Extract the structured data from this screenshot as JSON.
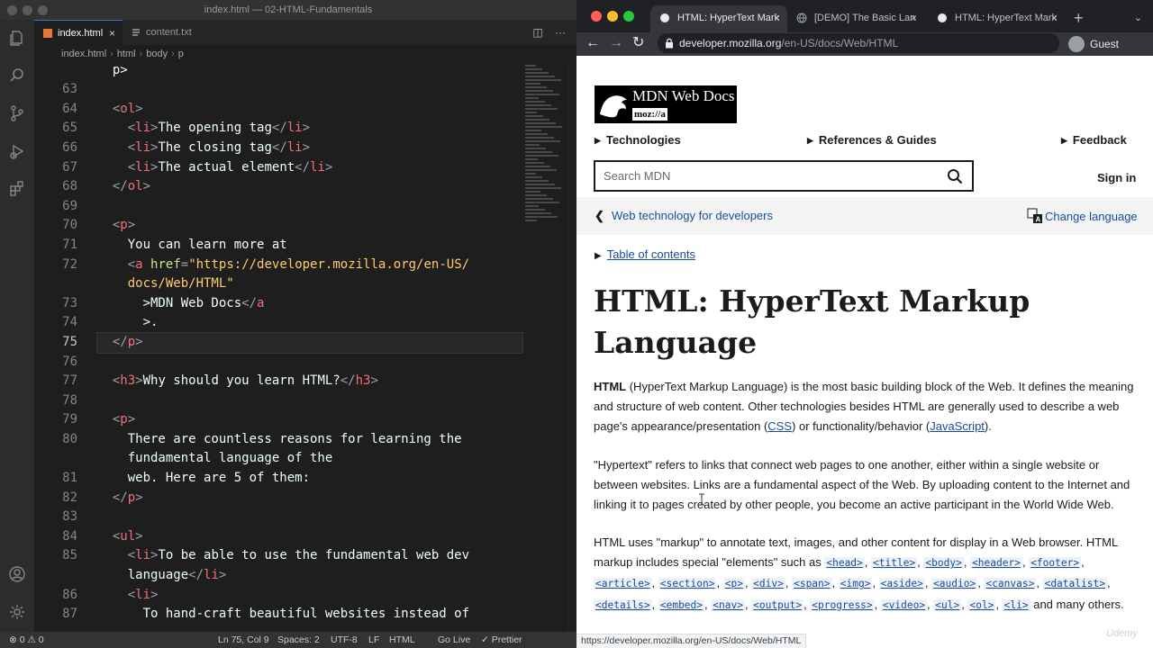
{
  "vscode": {
    "title": "index.html — 02-HTML-Fundamentals",
    "tabs": [
      {
        "label": "index.html",
        "close": "×"
      },
      {
        "label": "content.txt"
      }
    ],
    "breadcrumb": [
      "index.html",
      "html",
      "body",
      "p"
    ],
    "line_numbers": [
      "",
      "",
      "63",
      "64",
      "65",
      "66",
      "67",
      "68",
      "69",
      "70",
      "71",
      "72",
      "",
      "73",
      "74",
      "75",
      "76",
      "77",
      "78",
      "79",
      "80",
      "",
      "81",
      "82",
      "83",
      "84",
      "85",
      "",
      "86",
      "87"
    ],
    "current_line": "75",
    "status": {
      "problems": "⊗ 0 ⚠ 0",
      "position": "Ln 75, Col 9",
      "spaces": "Spaces: 2",
      "encoding": "UTF-8",
      "eol": "LF",
      "language": "HTML",
      "golive": "Go Live",
      "prettier": "✓ Prettier"
    },
    "icons": [
      "files-icon",
      "search-icon",
      "source-control-icon",
      "run-debug-icon",
      "extensions-icon",
      "account-icon",
      "settings-gear-icon"
    ]
  },
  "chrome": {
    "tabs": [
      {
        "label": "HTML: HyperText Mark",
        "close": "×"
      },
      {
        "label": "[DEMO] The Basic Lan",
        "close": "×"
      },
      {
        "label": "HTML: HyperText Mark",
        "close": "×"
      }
    ],
    "new_tab": "+",
    "url_host": "developer.mozilla.org",
    "url_path": "/en-US/docs/Web/HTML",
    "profile": "Guest",
    "status_url": "https://developer.mozilla.org/en-US/docs/Web/HTML",
    "colors": {
      "close": "#ff5f57",
      "minimize": "#febc2e",
      "zoom": "#28c840"
    }
  },
  "mdn": {
    "logo_text": "MDN Web Docs",
    "logo_sub": "moz://a",
    "nav": [
      "Technologies",
      "References & Guides",
      "Feedback"
    ],
    "search_placeholder": "Search MDN",
    "sign_in": "Sign in",
    "crumb": "Web technology for developers",
    "change_language": "Change language",
    "toc": "Table of contents",
    "title": "HTML: HyperText Markup Language",
    "p1": {
      "bold": "HTML",
      "text1": " (HyperText Markup Language) is the most basic building block of the Web. It defines the meaning and structure of web content. Other technologies besides HTML are generally used to describe a web page's appearance/presentation (",
      "link1": "CSS",
      "text2": ") or functionality/behavior (",
      "link2": "JavaScript",
      "text3": ")."
    },
    "p2": "\"Hypertext\" refers to links that connect web pages to one another, either within a single website or between websites. Links are a fundamental aspect of the Web. By uploading content to the Internet and linking it to pages created by other people, you become an active participant in the World Wide Web.",
    "p3": {
      "text1": "HTML uses \"markup\" to annotate text, images, and other content for display in a Web browser. HTML markup includes special \"elements\" such as ",
      "elements": [
        "<head>",
        "<title>",
        "<body>",
        "<header>",
        "<footer>",
        "<article>",
        "<section>",
        "<p>",
        "<div>",
        "<span>",
        "<img>",
        "<aside>",
        "<audio>",
        "<canvas>",
        "<datalist>",
        "<details>",
        "<embed>",
        "<nav>",
        "<output>",
        "<progress>",
        "<video>",
        "<ul>",
        "<ol>",
        "<li>"
      ],
      "text2": " and many others."
    }
  },
  "watermark": "Udemy"
}
